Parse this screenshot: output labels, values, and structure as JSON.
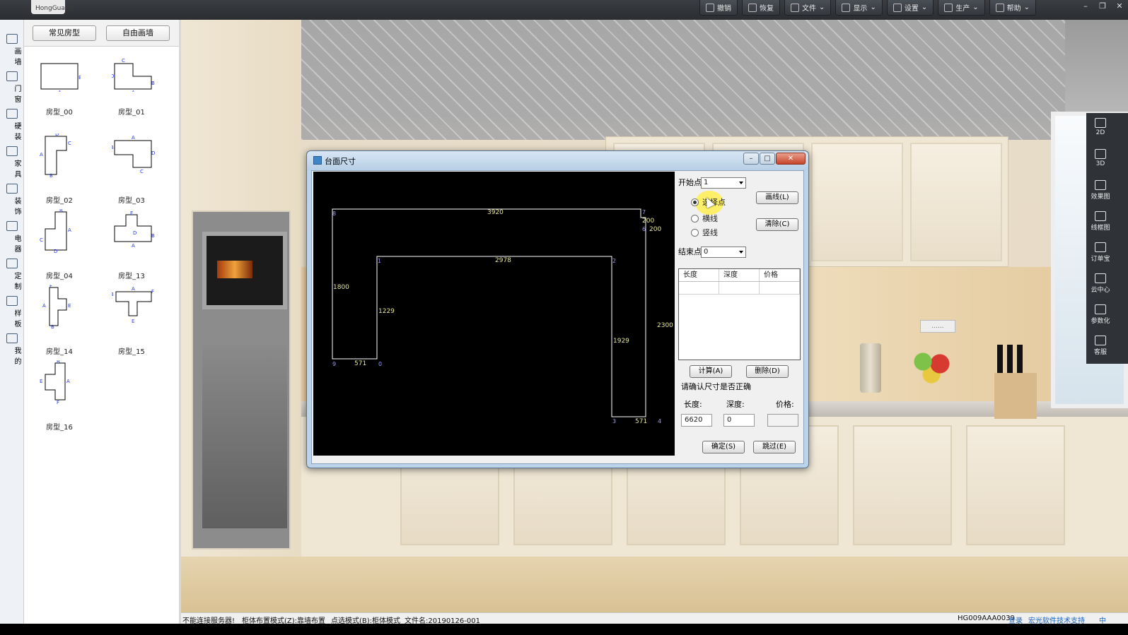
{
  "app": {
    "logo_text": "HongGuang",
    "toolbar": [
      {
        "label": "撤销",
        "icon": "undo-icon"
      },
      {
        "label": "恢复",
        "icon": "redo-icon"
      },
      {
        "label": "文件",
        "icon": "file-icon"
      },
      {
        "label": "显示",
        "icon": "eye-icon"
      },
      {
        "label": "设置",
        "icon": "gear-icon"
      },
      {
        "label": "生产",
        "icon": "production-icon"
      },
      {
        "label": "帮助",
        "icon": "help-icon"
      }
    ]
  },
  "left_rail": [
    {
      "label": "画墙",
      "icon": "pencil-icon"
    },
    {
      "label": "门窗",
      "icon": "window-icon"
    },
    {
      "label": "硬装",
      "icon": "paint-roller-icon"
    },
    {
      "label": "家具",
      "icon": "sofa-icon"
    },
    {
      "label": "装饰",
      "icon": "plant-icon"
    },
    {
      "label": "电器",
      "icon": "monitor-icon"
    },
    {
      "label": "定制",
      "icon": "grid-icon"
    },
    {
      "label": "样板",
      "icon": "home-icon"
    },
    {
      "label": "我的",
      "icon": "user-icon"
    }
  ],
  "room_panel": {
    "tabs": [
      "常见房型",
      "自由画墙"
    ],
    "rooms": [
      "房型_00",
      "房型_01",
      "房型_02",
      "房型_03",
      "房型_04",
      "房型_13",
      "房型_14",
      "房型_15",
      "房型_16"
    ]
  },
  "right_rail": [
    {
      "label": "2D",
      "icon": "2d-icon"
    },
    {
      "label": "3D",
      "icon": "3d-icon"
    },
    {
      "label": "效果图",
      "icon": "camera-icon"
    },
    {
      "label": "线框图",
      "icon": "wireframe-icon"
    },
    {
      "label": "订单宝",
      "icon": "cart-icon"
    },
    {
      "label": "云中心",
      "icon": "cloud-icon"
    },
    {
      "label": "参数化",
      "icon": "gear-icon"
    },
    {
      "label": "客服",
      "icon": "support-icon"
    }
  ],
  "dialog": {
    "title": "台面尺寸",
    "start_label": "开始点",
    "start_value": "1",
    "end_label": "结束点",
    "end_value": "0",
    "radios": [
      {
        "label": "选择点",
        "checked": true
      },
      {
        "label": "横线",
        "checked": false
      },
      {
        "label": "竖线",
        "checked": false
      }
    ],
    "draw_line_button": "画线(L)",
    "clear_button": "清除(C)",
    "table_headers": [
      "长度",
      "深度",
      "价格"
    ],
    "calc_button": "计算(A)",
    "delete_button": "删除(D)",
    "confirm_prompt": "请确认尺寸是否正确",
    "length_label": "长度:",
    "depth_label": "深度:",
    "price_label": "价格:",
    "length_value": "6620",
    "depth_value": "0",
    "price_value": "",
    "ok_button": "确定(S)",
    "skip_button": "跳过(E)"
  },
  "shape": {
    "point_labels": [
      "8",
      "7",
      "6",
      "1",
      "2",
      "9",
      "0",
      "3",
      "4"
    ],
    "dimensions": [
      "3920",
      "200",
      "200",
      "2978",
      "1800",
      "1229",
      "2300",
      "1929",
      "571",
      "571"
    ]
  },
  "status_bar": {
    "server": "不能连接服务器!",
    "layout_mode": "柜体布置模式(Z):靠墙布置",
    "select_mode": "点选模式(B):柜体模式",
    "filename": "文件名:20190126-001",
    "code": "HG009AAA0039",
    "login": "登录",
    "support": "宏光软件技术支持",
    "lang": "中"
  },
  "scene": {
    "panel_text": "......"
  }
}
